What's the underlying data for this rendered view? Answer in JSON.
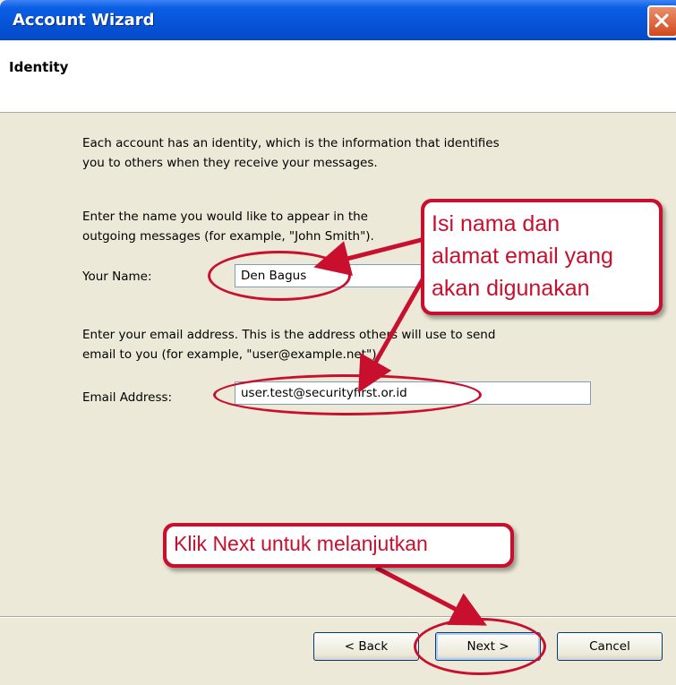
{
  "window": {
    "title": "Account Wizard"
  },
  "header": {
    "title": "Identity"
  },
  "body": {
    "intro_line1": "Each account has an identity, which is the information that identifies",
    "intro_line2": "you to others when they receive your messages.",
    "name_help_line1": "Enter the name you would like to appear in the",
    "name_help_line2": "outgoing messages (for example, \"John Smith\").",
    "name_label": "Your Name:",
    "name_value": "Den Bagus",
    "email_help_line1": "Enter your email address. This is the address others will use to send",
    "email_help_line2": "email to you (for example, \"user@example.net\").",
    "email_label": "Email Address:",
    "email_value": "user.test@securityfirst.or.id"
  },
  "buttons": {
    "back": "< Back",
    "next": "Next >",
    "cancel": "Cancel"
  },
  "annotations": {
    "callout1_line1": "Isi nama dan",
    "callout1_line2": "alamat email yang",
    "callout1_line3": "akan digunakan",
    "callout2": "Klik Next untuk melanjutkan"
  },
  "colors": {
    "titlebar": "#0653d6",
    "annotation_red": "#c8102e",
    "dialog_bg": "#ece9d8"
  },
  "icons": {
    "close": "close-icon"
  }
}
